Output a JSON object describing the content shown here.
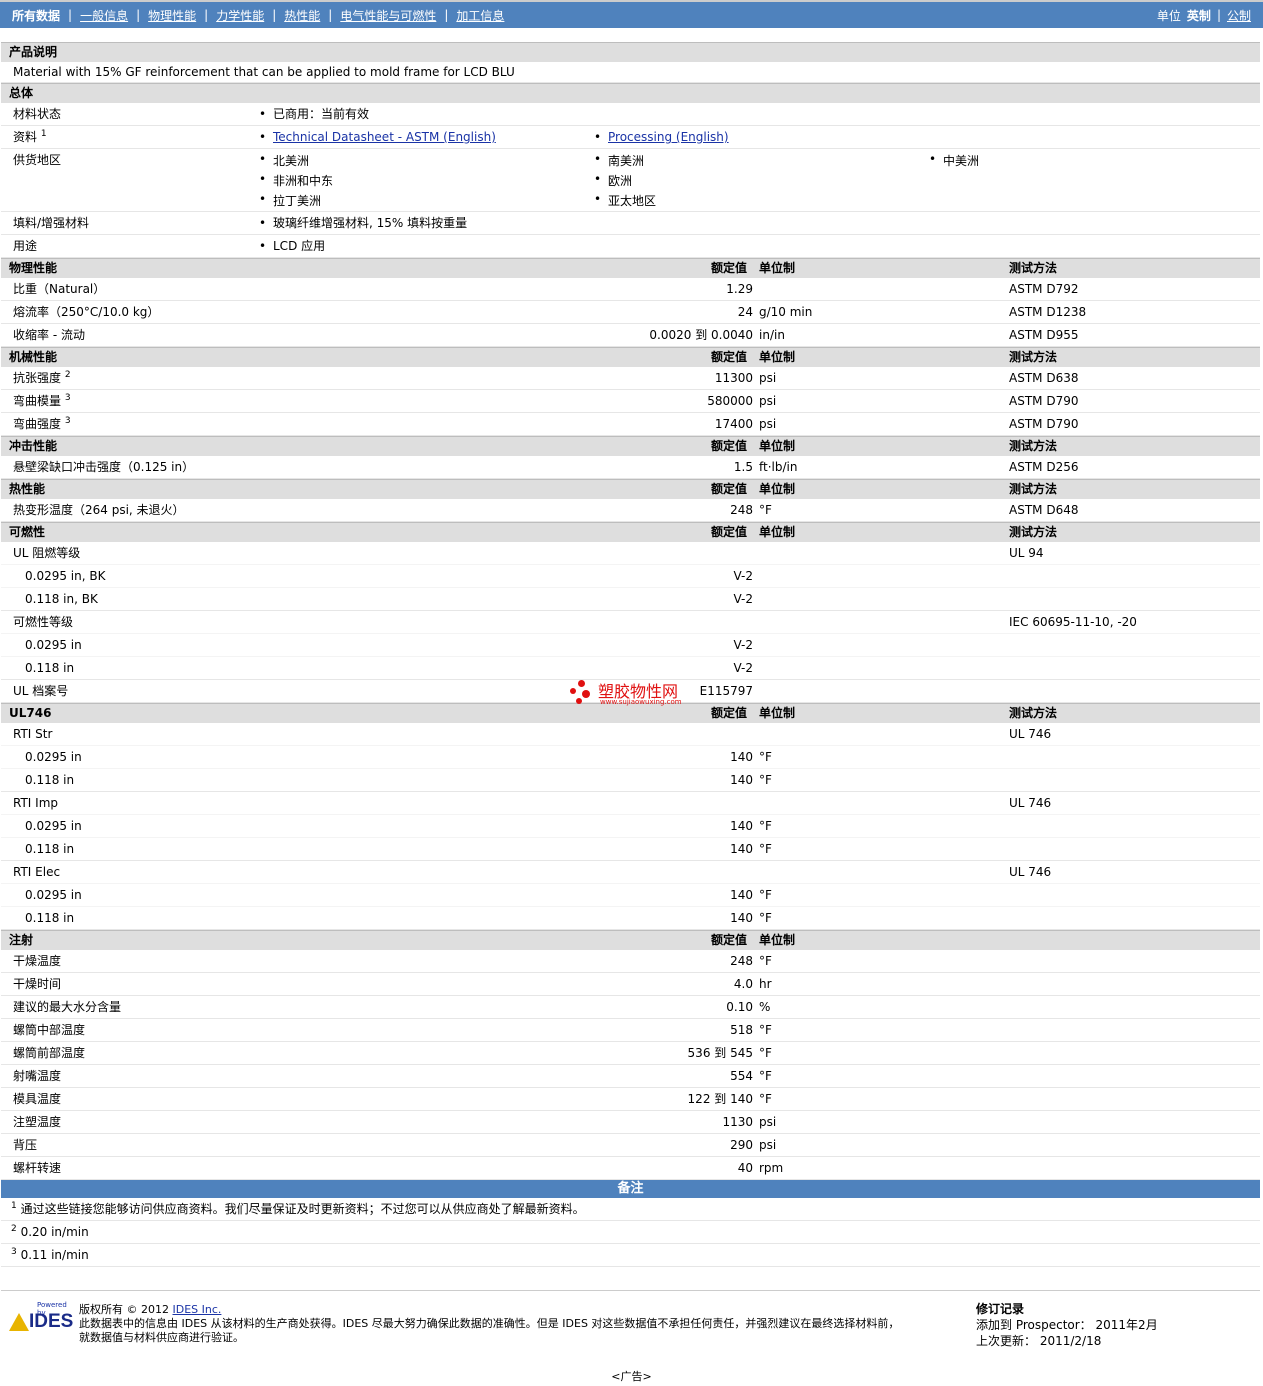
{
  "nav": {
    "items": [
      "所有数据",
      "一般信息",
      "物理性能",
      "力学性能",
      "热性能",
      "电气性能与可燃性",
      "加工信息"
    ],
    "unit_label": "单位",
    "unit_english": "英制",
    "unit_metric": "公制"
  },
  "headers": {
    "value": "额定值",
    "unit": "单位制",
    "method": "测试方法"
  },
  "product": {
    "title": "产品说明",
    "description": "Material with 15% GF reinforcement that can be applied to mold frame for LCD BLU"
  },
  "general": {
    "title": "总体",
    "status_label": "材料状态",
    "status_value": "已商用：当前有效",
    "docs_label": "资料",
    "docs_sup": "1",
    "doc1": "Technical Datasheet - ASTM (English)",
    "doc2": "Processing (English)",
    "region_label": "供货地区",
    "regions": [
      "北美洲",
      "南美洲",
      "中美洲",
      "非洲和中东",
      "欧洲",
      "拉丁美洲",
      "亚太地区"
    ],
    "filler_label": "填料/增强材料",
    "filler_value": "玻璃纤维增强材料, 15% 填料按重量",
    "use_label": "用途",
    "use_value": "LCD 应用"
  },
  "physical": {
    "title": "物理性能",
    "rows": [
      {
        "label": "比重（Natural）",
        "value": "1.29",
        "unit": "",
        "method": "ASTM D792"
      },
      {
        "label": "熔流率（250°C/10.0 kg）",
        "value": "24",
        "unit": "g/10 min",
        "method": "ASTM D1238"
      },
      {
        "label": "收缩率 - 流动",
        "value": "0.0020 到  0.0040",
        "unit": "in/in",
        "method": "ASTM D955"
      }
    ]
  },
  "mechanical": {
    "title": "机械性能",
    "rows": [
      {
        "label": "抗张强度",
        "sup": "2",
        "value": "11300",
        "unit": "psi",
        "method": "ASTM D638"
      },
      {
        "label": "弯曲模量",
        "sup": "3",
        "value": "580000",
        "unit": "psi",
        "method": "ASTM D790"
      },
      {
        "label": "弯曲强度",
        "sup": "3",
        "value": "17400",
        "unit": "psi",
        "method": "ASTM D790"
      }
    ]
  },
  "impact": {
    "title": "冲击性能",
    "rows": [
      {
        "label": "悬壁梁缺口冲击强度（0.125 in）",
        "value": "1.5",
        "unit": "ft·lb/in",
        "method": "ASTM D256"
      }
    ]
  },
  "thermal": {
    "title": "热性能",
    "rows": [
      {
        "label": "热变形温度（264 psi, 未退火）",
        "value": "248",
        "unit": "°F",
        "method": "ASTM D648"
      }
    ]
  },
  "flammability": {
    "title": "可燃性",
    "ul_label": "UL 阻燃等级",
    "ul_method": "UL 94",
    "ul_rows": [
      {
        "label": "0.0295 in, BK",
        "value": "V-2"
      },
      {
        "label": "0.118 in, BK",
        "value": "V-2"
      }
    ],
    "flam_label": "可燃性等级",
    "flam_method": "IEC 60695-11-10, -20",
    "flam_rows": [
      {
        "label": "0.0295 in",
        "value": "V-2"
      },
      {
        "label": "0.118 in",
        "value": "V-2"
      }
    ],
    "file_label": "UL 档案号",
    "file_value": "E115797"
  },
  "ul746": {
    "title": "UL746",
    "groups": [
      {
        "label": "RTI Str",
        "method": "UL 746",
        "rows": [
          {
            "label": "0.0295 in",
            "value": "140",
            "unit": "°F"
          },
          {
            "label": "0.118 in",
            "value": "140",
            "unit": "°F"
          }
        ]
      },
      {
        "label": "RTI Imp",
        "method": "UL 746",
        "rows": [
          {
            "label": "0.0295 in",
            "value": "140",
            "unit": "°F"
          },
          {
            "label": "0.118 in",
            "value": "140",
            "unit": "°F"
          }
        ]
      },
      {
        "label": "RTI Elec",
        "method": "UL 746",
        "rows": [
          {
            "label": "0.0295 in",
            "value": "140",
            "unit": "°F"
          },
          {
            "label": "0.118 in",
            "value": "140",
            "unit": "°F"
          }
        ]
      }
    ]
  },
  "injection": {
    "title": "注射",
    "rows": [
      {
        "label": "干燥温度",
        "value": "248",
        "unit": "°F"
      },
      {
        "label": "干燥时间",
        "value": "4.0",
        "unit": "hr"
      },
      {
        "label": "建议的最大水分含量",
        "value": "0.10",
        "unit": "%"
      },
      {
        "label": "螺筒中部温度",
        "value": "518",
        "unit": "°F"
      },
      {
        "label": "螺筒前部温度",
        "value": "536 到  545",
        "unit": "°F"
      },
      {
        "label": "射嘴温度",
        "value": "554",
        "unit": "°F"
      },
      {
        "label": "模具温度",
        "value": "122 到  140",
        "unit": "°F"
      },
      {
        "label": "注塑温度",
        "value": "1130",
        "unit": "psi"
      },
      {
        "label": "背压",
        "value": "290",
        "unit": "psi"
      },
      {
        "label": "螺杆转速",
        "value": "40",
        "unit": "rpm"
      }
    ]
  },
  "notes": {
    "title": "备注",
    "items": [
      {
        "sup": "1",
        "text": "通过这些链接您能够访问供应商资料。我们尽量保证及时更新资料；不过您可以从供应商处了解最新资料。"
      },
      {
        "sup": "2",
        "text": "0.20 in/min"
      },
      {
        "sup": "3",
        "text": "0.11 in/min"
      }
    ]
  },
  "footer": {
    "powered_by": "Powered by",
    "logo_text": "IDES",
    "copyright_prefix": "版权所有  © 2012",
    "copyright_link": "IDES Inc.",
    "disclaimer_1": "此数据表中的信息由  IDES 从该材料的生产商处获得。IDES 尽最大努力确保此数据的准确性。但是  IDES 对这些数据值不承担任何责任，并强烈建议在最终选择材料前，",
    "disclaimer_2": "就数据值与材料供应商进行验证。",
    "rev_title": "修订记录",
    "added_label": "添加到  Prospector：",
    "added_value": "2011年2月",
    "updated_label": "上次更新：",
    "updated_value": "2011/2/18",
    "ad": "<广告>"
  },
  "watermark": {
    "text": "塑胶物性网",
    "url": "www.sujiaowuxing.com"
  },
  "colors": {
    "nav_bg": "#4f82bd",
    "section_bg": "#dedede",
    "link": "#1a33a6",
    "watermark": "#e01010"
  }
}
